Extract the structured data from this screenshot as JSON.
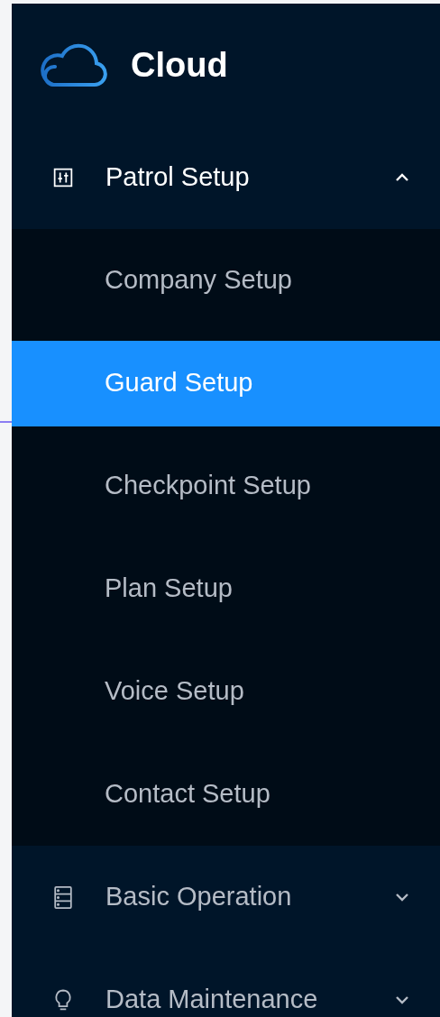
{
  "logo": {
    "text": "Cloud"
  },
  "menu": [
    {
      "label": "Patrol Setup",
      "expanded": true,
      "children": [
        {
          "label": "Company Setup",
          "selected": false
        },
        {
          "label": "Guard Setup",
          "selected": true
        },
        {
          "label": "Checkpoint Setup",
          "selected": false
        },
        {
          "label": "Plan Setup",
          "selected": false
        },
        {
          "label": "Voice Setup",
          "selected": false
        },
        {
          "label": "Contact Setup",
          "selected": false
        }
      ]
    },
    {
      "label": "Basic Operation",
      "expanded": false
    },
    {
      "label": "Data Maintenance",
      "expanded": false
    }
  ]
}
